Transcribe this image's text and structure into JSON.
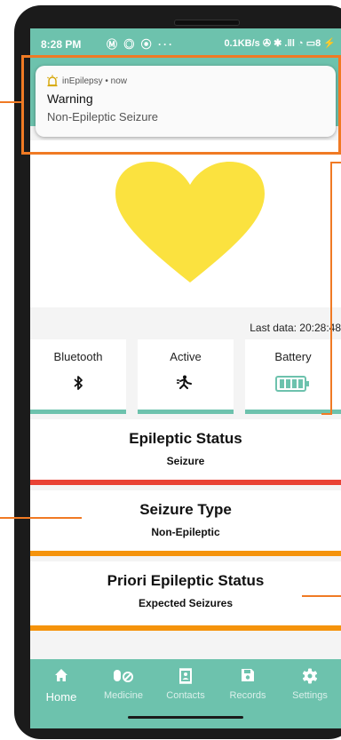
{
  "status_bar": {
    "time": "8:28 PM",
    "indicators": "Ⓜ ◎ ⦿ ···",
    "network": "0.1KB/s ✇ ✱ .‖l ◔ ▭8 ⚡"
  },
  "notification": {
    "app": "inEpilepsy • now",
    "title": "Warning",
    "text": "Non-Epileptic Seizure",
    "icon": "siren-icon"
  },
  "heart": {
    "color": "#fbe23f"
  },
  "last_data": "Last data: 20:28:48",
  "tiles": [
    {
      "label": "Bluetooth",
      "icon": "bluetooth-icon"
    },
    {
      "label": "Active",
      "icon": "running-icon"
    },
    {
      "label": "Battery",
      "icon": "battery-full-icon"
    }
  ],
  "epileptic_status": {
    "title": "Epileptic Status",
    "value": "Seizure",
    "color": "#e94234"
  },
  "seizure_type": {
    "title": "Seizure Type",
    "value": "Non-Epileptic",
    "color": "#f5930c"
  },
  "priori_status": {
    "title": "Priori Epileptic Status",
    "value": "Expected Seizures",
    "color": "#f5930c"
  },
  "nav": [
    {
      "label": "Home",
      "icon": "home-icon"
    },
    {
      "label": "Medicine",
      "icon": "pills-icon"
    },
    {
      "label": "Contacts",
      "icon": "contacts-icon"
    },
    {
      "label": "Records",
      "icon": "save-icon"
    },
    {
      "label": "Settings",
      "icon": "gear-icon"
    }
  ],
  "colors": {
    "primary": "#6dc2ad",
    "annotation": "#f07a24"
  }
}
